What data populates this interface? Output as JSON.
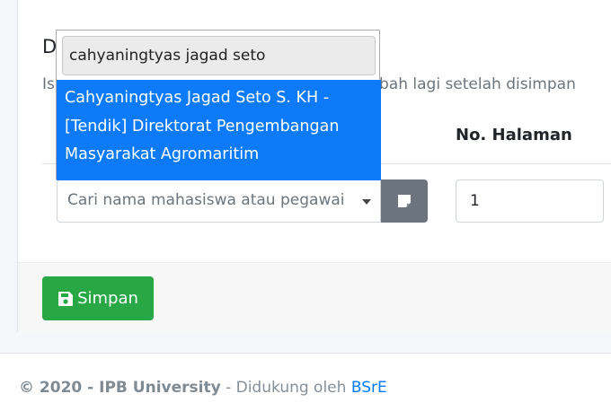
{
  "form": {
    "section_letter": "D",
    "hint_prefix": "Is",
    "hint_suffix": "bah lagi setelah disimpan",
    "page_column_header": "No. Halaman",
    "select_placeholder": "Cari nama mahasiswa atau pegawai",
    "page_value": "1",
    "save_label": "Simpan"
  },
  "dropdown": {
    "search_value": "cahyaningtyas jagad seto",
    "option_lines": [
      "Cahyaningtyas Jagad Seto S. KH -",
      "[Tendik] Direktorat Pengembangan",
      "Masyarakat Agromaritim"
    ]
  },
  "footer": {
    "copyright": "© 2020 - IPB University",
    "supported_by": " - Didukung oleh ",
    "link_label": "BSrE"
  },
  "colors": {
    "save_green": "#28a745",
    "option_highlight": "#0d7bf9",
    "note_button_gray": "#6c757d",
    "link_blue": "#007bff"
  },
  "icons": {
    "save": "floppy-disk-icon",
    "note": "sticky-note-icon",
    "caret": "caret-down-icon"
  }
}
